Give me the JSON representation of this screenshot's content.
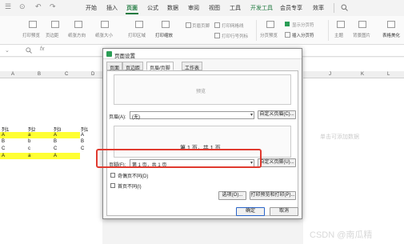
{
  "app": {
    "quick_access": [
      "☰",
      "⊙",
      "↶",
      "↷"
    ],
    "menu": [
      "开始",
      "插入",
      "页面",
      "公式",
      "数据",
      "审阅",
      "视图",
      "工具",
      "开发工具",
      "会员专享",
      "效率"
    ],
    "active_menu": "页面",
    "search_icon": "search-icon",
    "accent": "#1f7a3f"
  },
  "ribbon": {
    "groups": [
      {
        "label": "打印预览"
      },
      {
        "label": "页边距"
      },
      {
        "label": "纸张方向"
      },
      {
        "label": "纸张大小"
      },
      {
        "label": "打印区域"
      },
      {
        "label": "打印缩放"
      },
      {
        "label": "页眉页脚"
      }
    ],
    "options": [
      "打印网格线",
      "打印行号列标"
    ],
    "right": {
      "show_pagebreak": "显示分页符",
      "insert_pagebreak": "插入分页符",
      "pagebreak_preview": "分页预览",
      "theme": "主题",
      "background": "背景图片",
      "beautify": "表格美化"
    }
  },
  "formula_bar": {
    "zoom_icon": "zoom-icon",
    "fx": "fx"
  },
  "grid": {
    "columns": [
      "A",
      "B",
      "C",
      "D"
    ],
    "right_columns": [
      "J",
      "K",
      "L"
    ],
    "header_row": [
      "列1",
      "列2",
      "列3",
      "列1"
    ],
    "rows": [
      [
        "A",
        "a",
        "A",
        "A"
      ],
      [
        "B",
        "b",
        "B",
        "B"
      ],
      [
        "C",
        "c",
        "C",
        "C"
      ],
      [
        "A",
        "a",
        "A",
        ""
      ]
    ],
    "highlight": "#ffff33",
    "right_hint": "单击可添加数据"
  },
  "dialog": {
    "title": "页面设置",
    "tabs": [
      "页面",
      "页边距",
      "页眉/页脚",
      "工作表"
    ],
    "active_tab": "页眉/页脚",
    "header_preview": "预览",
    "header_label": "页眉(A):",
    "header_value": "(无)",
    "custom_header": "自定义页眉(C)...",
    "footer_preview": "第 1 页，共 1 页",
    "footer_label": "页脚(F):",
    "footer_value": "第 1 页，共 1 页",
    "custom_footer": "自定义页脚(U)...",
    "odd_even": "奇偶页不同(D)",
    "first_page": "首页不同(I)",
    "options_btn": "选项(O)...",
    "print_preview_btn": "打印预览和打印(P)...",
    "ok_btn": "确定",
    "cancel_btn": "取消"
  },
  "watermark": "CSDN @南瓜精"
}
